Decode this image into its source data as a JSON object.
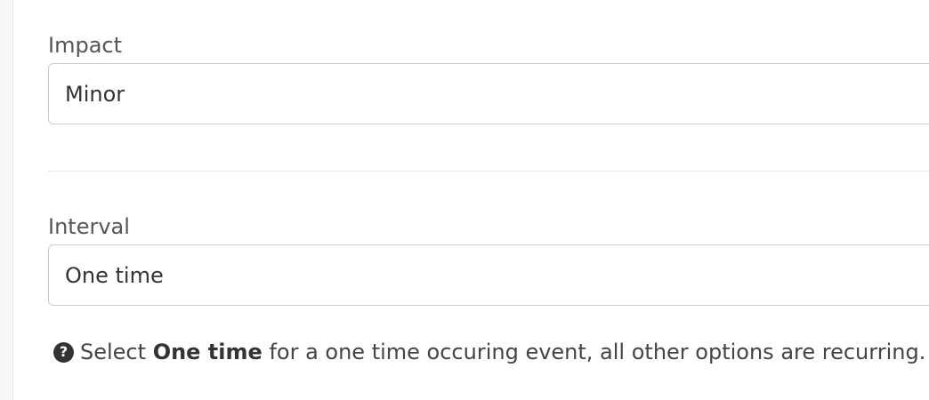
{
  "impact": {
    "label": "Impact",
    "value": "Minor"
  },
  "interval": {
    "label": "Interval",
    "value": "One time"
  },
  "help": {
    "icon": "question-circle-icon",
    "prefix": "Select",
    "bold": "One time",
    "suffix": "for a one time occuring event, all other options are recurring."
  }
}
